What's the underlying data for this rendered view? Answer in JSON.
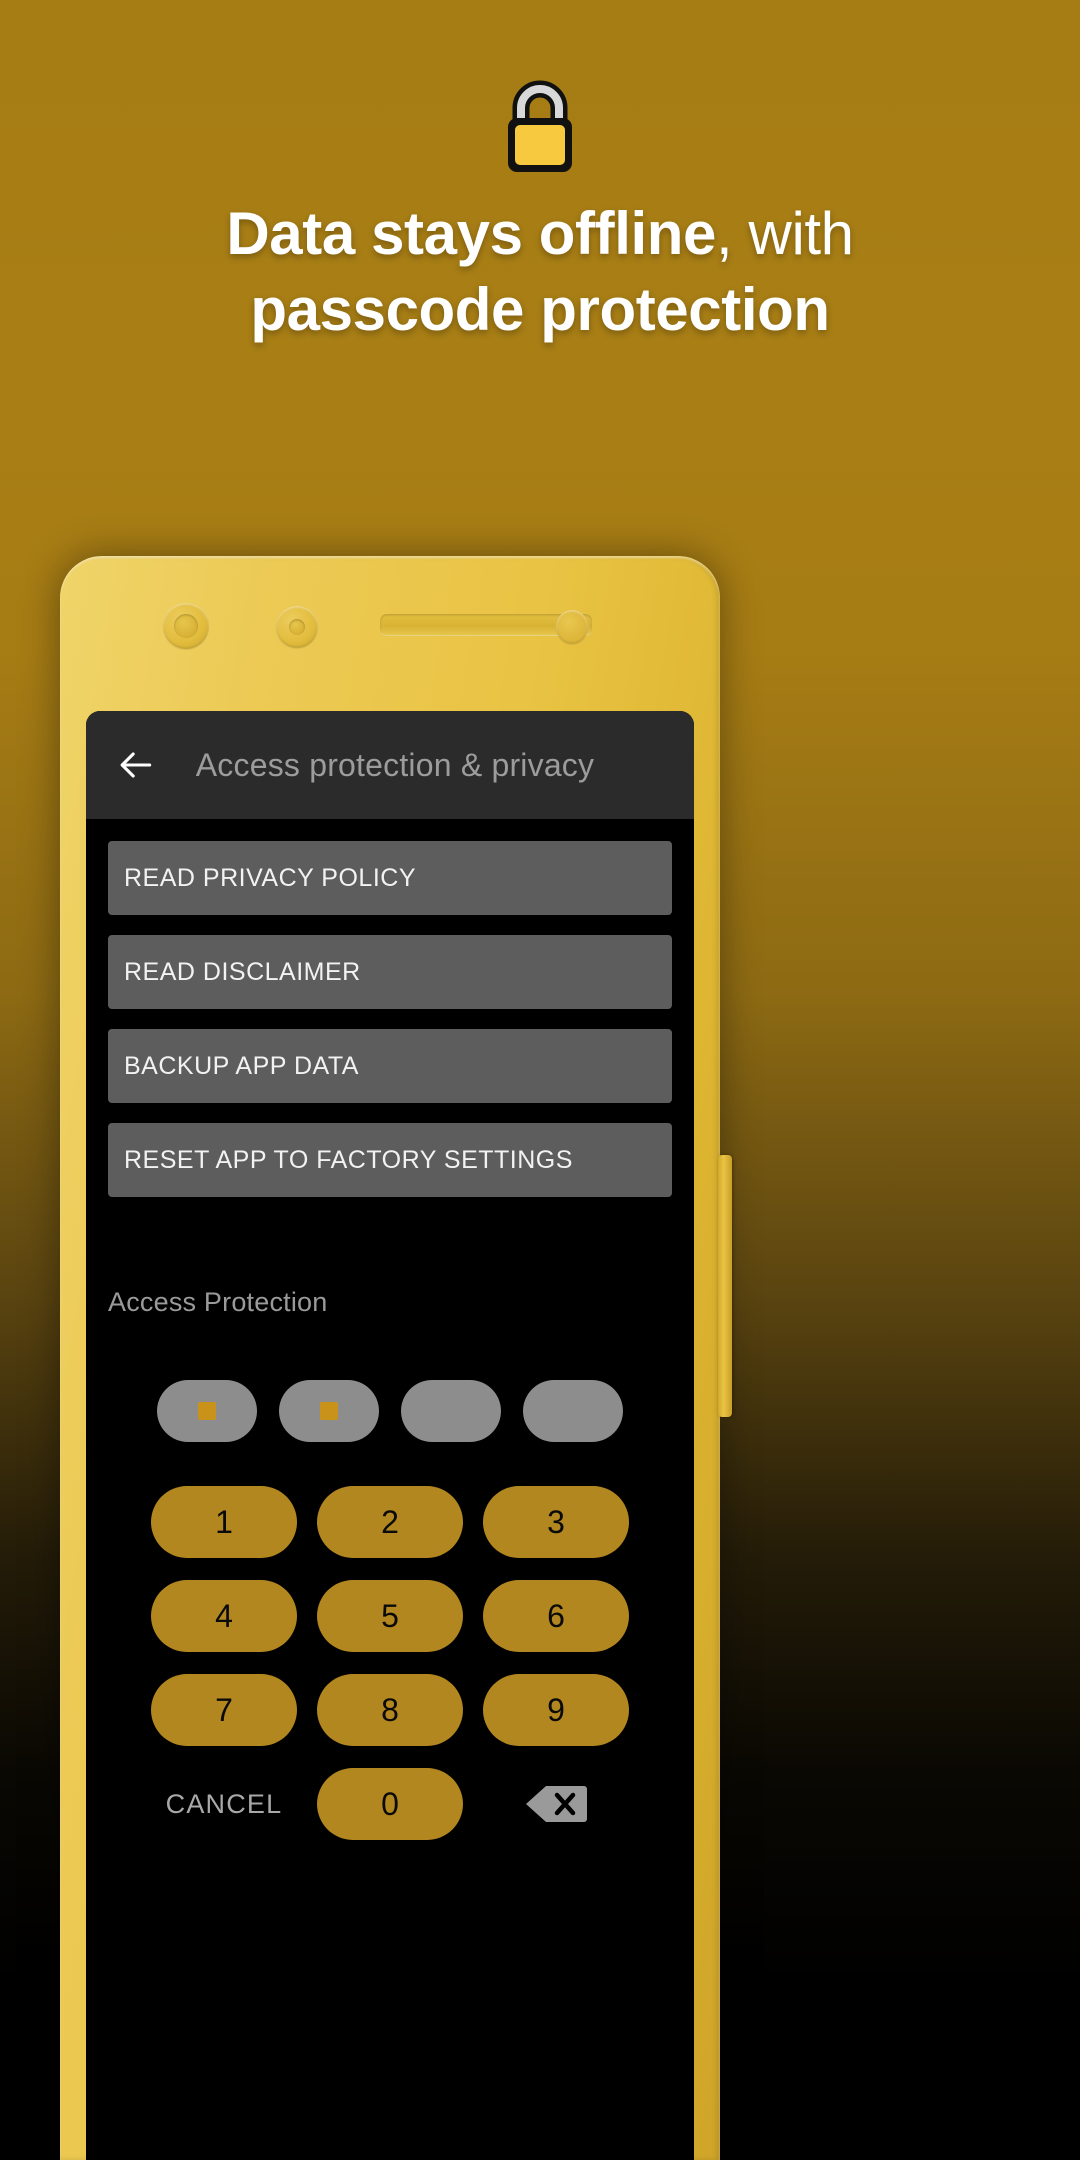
{
  "hero": {
    "icon": "padlock-icon",
    "headline_line1_bold": "Data stays offline",
    "headline_line1_rest": ", with",
    "headline_line2_bold": "passcode protection"
  },
  "colors": {
    "background_top": "#a67c14",
    "background_bottom": "#000000",
    "phone_body": "#e9c343",
    "appbar": "#2b2b2b",
    "screen": "#000000",
    "action_button": "#5d5d5d",
    "key": "#b3871f",
    "pin_pill": "#8d8d8d",
    "pin_dot": "#c9921b",
    "lock_body": "#f6c93f"
  },
  "phone": {
    "hardware": {
      "camera": "camera-icon",
      "proximity_sensor": "proximity-sensor-icon",
      "earpiece_speaker": "speaker-grille",
      "light_sensor": "light-sensor-icon",
      "power_button": "power-button"
    }
  },
  "app": {
    "appbar": {
      "back_icon": "back-arrow-icon",
      "title": "Access protection & privacy"
    },
    "actions": [
      {
        "label": "READ PRIVACY POLICY"
      },
      {
        "label": "READ DISCLAIMER"
      },
      {
        "label": "BACKUP APP DATA"
      },
      {
        "label": "RESET APP TO FACTORY SETTINGS"
      }
    ],
    "access_protection": {
      "section_label": "Access Protection",
      "pin_length": 4,
      "pin_filled": [
        true,
        true,
        false,
        false
      ],
      "keypad": {
        "rows": [
          [
            "1",
            "2",
            "3"
          ],
          [
            "4",
            "5",
            "6"
          ],
          [
            "7",
            "8",
            "9"
          ]
        ],
        "cancel_label": "CANCEL",
        "zero_label": "0",
        "backspace_icon": "backspace-icon"
      }
    }
  }
}
